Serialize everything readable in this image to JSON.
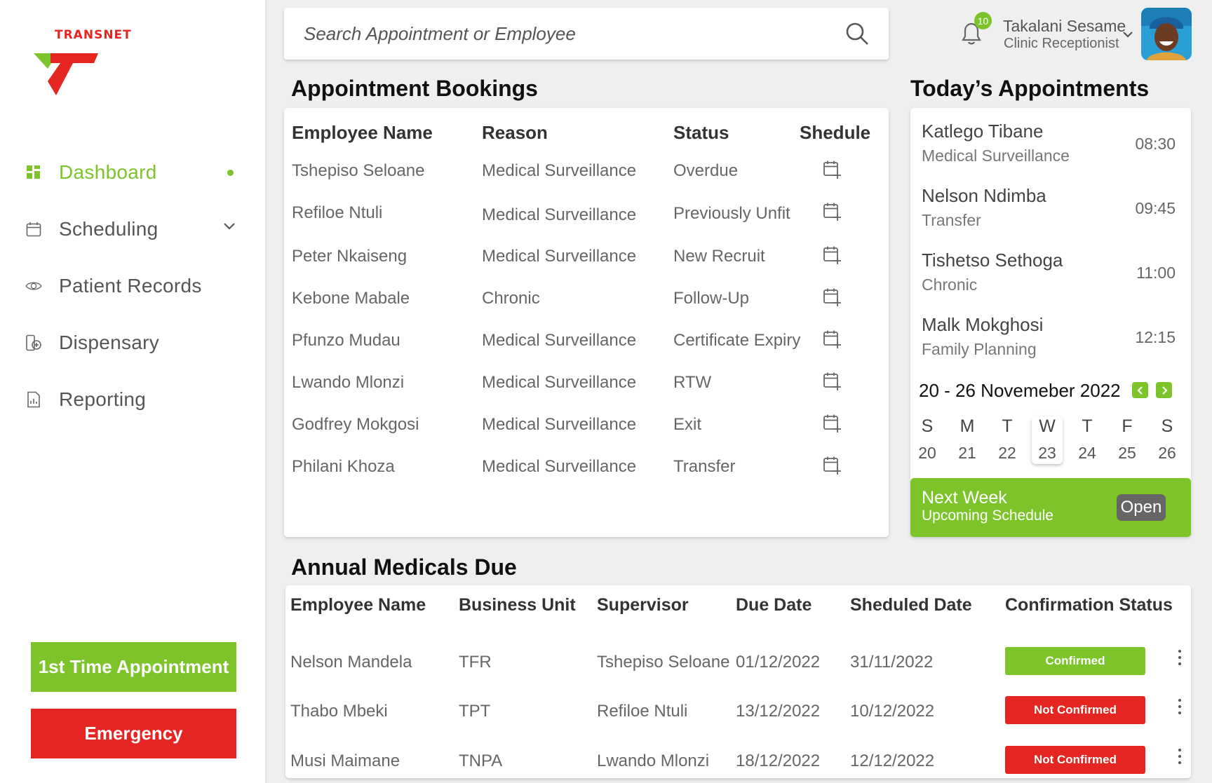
{
  "logo": {
    "text": "TRANSNET"
  },
  "colors": {
    "accent": "#7dc42b",
    "danger": "#e52521",
    "muted": "#666666"
  },
  "sidebar": {
    "items": [
      {
        "label": "Dashboard",
        "icon": "grid-icon",
        "active": true
      },
      {
        "label": "Scheduling",
        "icon": "calendar-icon"
      },
      {
        "label": "Patient Records",
        "icon": "eye-icon"
      },
      {
        "label": "Dispensary",
        "icon": "medicine-icon"
      },
      {
        "label": "Reporting",
        "icon": "report-icon"
      }
    ],
    "first_time_label": "1st Time Appointment",
    "emergency_label": "Emergency"
  },
  "search": {
    "placeholder": "Search Appointment or Employee"
  },
  "header": {
    "notification_count": "10",
    "user_name": "Takalani Sesame",
    "user_role": "Clinic Receptionist"
  },
  "bookings": {
    "title": "Appointment Bookings",
    "columns": [
      "Employee Name",
      "Reason",
      "Status",
      "Shedule"
    ],
    "rows": [
      {
        "name": "Tshepiso Seloane",
        "reason": "Medical Surveillance",
        "status": "Overdue"
      },
      {
        "name": "Refiloe Ntuli",
        "reason": "Medical Surveillance",
        "status": "Previously Unfit"
      },
      {
        "name": "Peter Nkaiseng",
        "reason": "Medical Surveillance",
        "status": "New Recruit"
      },
      {
        "name": "Kebone Mabale",
        "reason": "Chronic",
        "status": "Follow-Up"
      },
      {
        "name": "Pfunzo Mudau",
        "reason": "Medical Surveillance",
        "status": "Certificate Expiry"
      },
      {
        "name": "Lwando Mlonzi",
        "reason": "Medical Surveillance",
        "status": "RTW"
      },
      {
        "name": "Godfrey Mokgosi",
        "reason": "Medical Surveillance",
        "status": "Exit"
      },
      {
        "name": "Philani Khoza",
        "reason": "Medical Surveillance",
        "status": "Transfer"
      }
    ]
  },
  "today": {
    "title": "Today’s Appointments",
    "appointments": [
      {
        "name": "Katlego Tibane",
        "reason": "Medical Surveillance",
        "time": "08:30"
      },
      {
        "name": "Nelson Ndimba",
        "reason": "Transfer",
        "time": "09:45"
      },
      {
        "name": "Tishetso Sethoga",
        "reason": "Chronic",
        "time": "11:00"
      },
      {
        "name": "Malk Mokghosi",
        "reason": "Family Planning",
        "time": "12:15"
      }
    ],
    "week_range": "20 - 26 Novemeber 2022",
    "days": [
      {
        "letter": "S",
        "num": "20"
      },
      {
        "letter": "M",
        "num": "21"
      },
      {
        "letter": "T",
        "num": "22"
      },
      {
        "letter": "W",
        "num": "23",
        "selected": true
      },
      {
        "letter": "T",
        "num": "24"
      },
      {
        "letter": "F",
        "num": "25"
      },
      {
        "letter": "S",
        "num": "26"
      }
    ],
    "next_week": {
      "title": "Next Week",
      "subtitle": "Upcoming Schedule",
      "open_label": "Open"
    }
  },
  "medicals": {
    "title": "Annual Medicals Due",
    "columns": [
      "Employee Name",
      "Business Unit",
      "Supervisor",
      "Due Date",
      "Sheduled Date",
      "Confirmation Status"
    ],
    "rows": [
      {
        "name": "Nelson Mandela",
        "unit": "TFR",
        "supervisor": "Tshepiso Seloane",
        "due": "01/12/2022",
        "scheduled": "31/11/2022",
        "status": "Confirmed",
        "status_color": "#7dc42b"
      },
      {
        "name": "Thabo Mbeki",
        "unit": "TPT",
        "supervisor": "Refiloe Ntuli",
        "due": "13/12/2022",
        "scheduled": "10/12/2022",
        "status": "Not Confirmed",
        "status_color": "#e52521"
      },
      {
        "name": "Musi Maimane",
        "unit": "TNPA",
        "supervisor": "Lwando Mlonzi",
        "due": "18/12/2022",
        "scheduled": "12/12/2022",
        "status": "Not Confirmed",
        "status_color": "#e52521"
      }
    ]
  }
}
